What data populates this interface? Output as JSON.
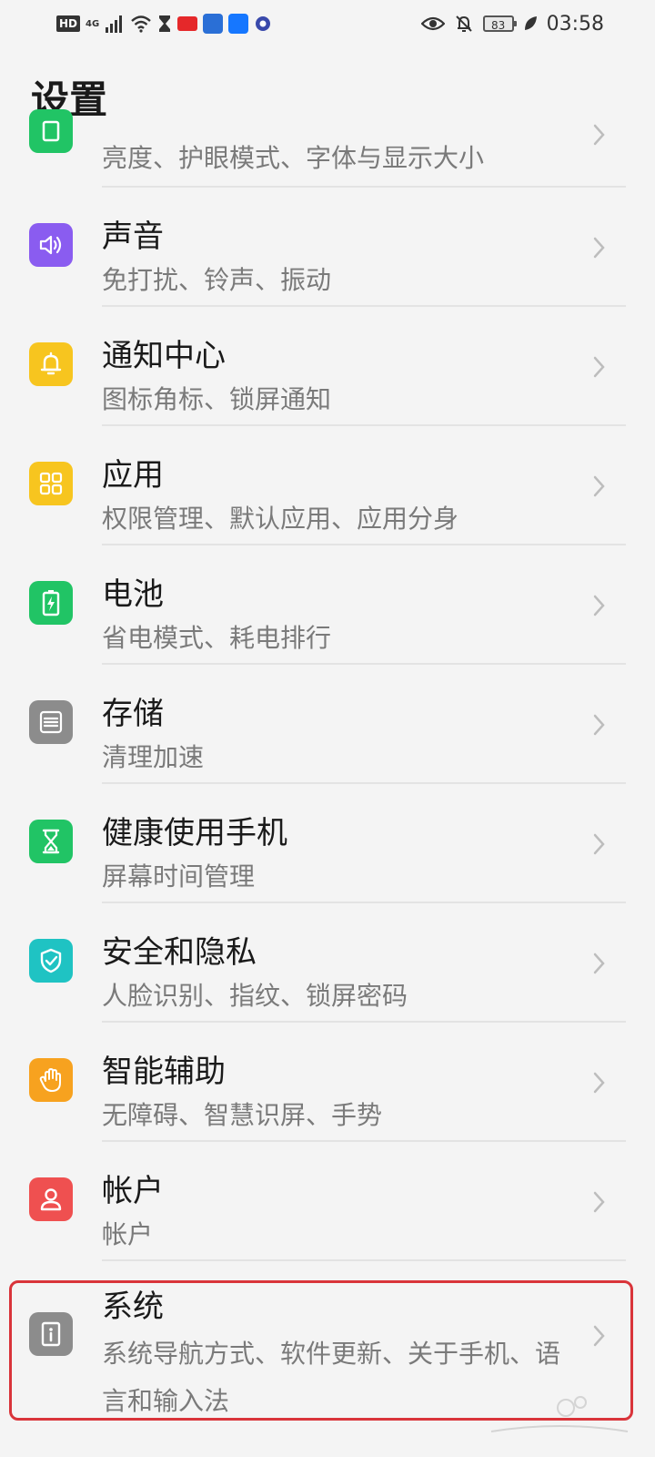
{
  "status_bar": {
    "hd": "HD",
    "network": "4G",
    "battery": "83",
    "time": "03:58"
  },
  "header": {
    "title": "设置"
  },
  "settings": [
    {
      "key": "display",
      "title": "",
      "subtitle": "亮度、护眼模式、字体与显示大小",
      "icon": "display-icon",
      "color": "#21c465"
    },
    {
      "key": "sound",
      "title": "声音",
      "subtitle": "免打扰、铃声、振动",
      "icon": "speaker-icon",
      "color": "#8a5cf0"
    },
    {
      "key": "notification",
      "title": "通知中心",
      "subtitle": "图标角标、锁屏通知",
      "icon": "bell-icon",
      "color": "#f7c51f"
    },
    {
      "key": "apps",
      "title": "应用",
      "subtitle": "权限管理、默认应用、应用分身",
      "icon": "apps-grid-icon",
      "color": "#f7c51f"
    },
    {
      "key": "battery",
      "title": "电池",
      "subtitle": "省电模式、耗电排行",
      "icon": "battery-icon",
      "color": "#21c465"
    },
    {
      "key": "storage",
      "title": "存储",
      "subtitle": "清理加速",
      "icon": "storage-icon",
      "color": "#8c8c8c"
    },
    {
      "key": "digital-balance",
      "title": "健康使用手机",
      "subtitle": "屏幕时间管理",
      "icon": "hourglass-icon",
      "color": "#21c465"
    },
    {
      "key": "security",
      "title": "安全和隐私",
      "subtitle": "人脸识别、指纹、锁屏密码",
      "icon": "shield-icon",
      "color": "#1fc3c3"
    },
    {
      "key": "accessibility",
      "title": "智能辅助",
      "subtitle": "无障碍、智慧识屏、手势",
      "icon": "hand-icon",
      "color": "#f7a21f"
    },
    {
      "key": "accounts",
      "title": "帐户",
      "subtitle": "帐户",
      "icon": "user-icon",
      "color": "#ef5050"
    },
    {
      "key": "system",
      "title": "系统",
      "subtitle": "系统导航方式、软件更新、关于手机、语言和输入法",
      "icon": "info-icon",
      "color": "#8c8c8c"
    }
  ],
  "colors": {
    "highlight": "#d9343a",
    "background": "#f4f4f4"
  }
}
